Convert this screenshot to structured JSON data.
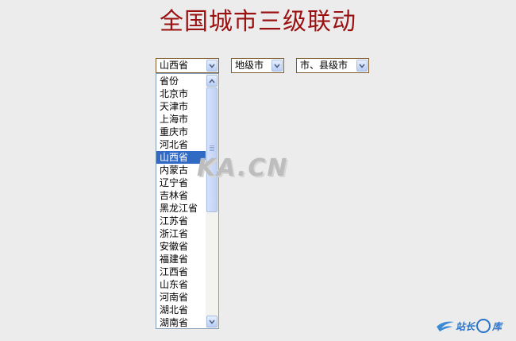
{
  "title": "全国城市三级联动",
  "selects": {
    "province": "山西省",
    "city": "地级市",
    "county": "市、县级市"
  },
  "province_options": [
    "省份",
    "北京市",
    "天津市",
    "上海市",
    "重庆市",
    "河北省",
    "山西省",
    "内蒙古",
    "辽宁省",
    "吉林省",
    "黑龙江省",
    "江苏省",
    "浙江省",
    "安徽省",
    "福建省",
    "江西省",
    "山东省",
    "河南省",
    "湖北省",
    "湖南省"
  ],
  "selected_index": 6,
  "watermark": "KA.CN",
  "logo": {
    "text_a": "站长",
    "text_b": "库"
  },
  "colors": {
    "title": "#9a1111",
    "selected": "#316ac5",
    "arrow": "#4d6185"
  }
}
